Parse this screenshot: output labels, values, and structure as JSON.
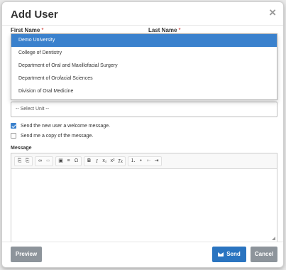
{
  "modal": {
    "title": "Add User",
    "close_icon": "×"
  },
  "fields": {
    "first_name_label": "First Name",
    "last_name_label": "Last Name",
    "required_marker": "*"
  },
  "dropdown": {
    "options": [
      {
        "label": "Demo University",
        "selected": true
      },
      {
        "label": "College of Dentistry",
        "selected": false
      },
      {
        "label": "Department of Oral and Maxillofacial Surgery",
        "selected": false
      },
      {
        "label": "Department of Orofacial Sciences",
        "selected": false
      },
      {
        "label": "Division of Oral Medicine",
        "selected": false
      }
    ]
  },
  "unit_select": {
    "value": "-- Select Unit --"
  },
  "checkboxes": [
    {
      "label": "Send the new user a welcome message.",
      "checked": true
    },
    {
      "label": "Send me a copy of the message.",
      "checked": false
    }
  ],
  "message": {
    "label": "Message",
    "toolbar_groups": [
      [
        {
          "icon": "paste-icon",
          "glyph": "⎘"
        },
        {
          "icon": "paste-text-icon",
          "glyph": "⎘"
        }
      ],
      [
        {
          "icon": "link-icon",
          "glyph": "∞"
        },
        {
          "icon": "unlink-icon",
          "glyph": "∞",
          "disabled": true
        }
      ],
      [
        {
          "icon": "image-icon",
          "glyph": "▣"
        },
        {
          "icon": "horizontal-line-icon",
          "glyph": "≡"
        },
        {
          "icon": "special-char-icon",
          "glyph": "Ω"
        }
      ],
      [
        {
          "icon": "bold-icon",
          "glyph": "B"
        },
        {
          "icon": "italic-icon",
          "glyph": "I"
        },
        {
          "icon": "subscript-icon",
          "glyph": "x₂"
        },
        {
          "icon": "superscript-icon",
          "glyph": "x²"
        },
        {
          "icon": "clear-format-icon",
          "glyph": "Tx"
        }
      ],
      [
        {
          "icon": "numbered-list-icon",
          "glyph": "⒈"
        },
        {
          "icon": "bulleted-list-icon",
          "glyph": "•"
        },
        {
          "icon": "outdent-icon",
          "glyph": "⇤"
        },
        {
          "icon": "indent-icon",
          "glyph": "⇥"
        }
      ]
    ]
  },
  "buttons": {
    "preview": "Preview",
    "send": "Send",
    "cancel": "Cancel"
  },
  "colors": {
    "accent": "#3a81cd",
    "send_button": "#2a74c0",
    "secondary_button": "#8d949b"
  }
}
